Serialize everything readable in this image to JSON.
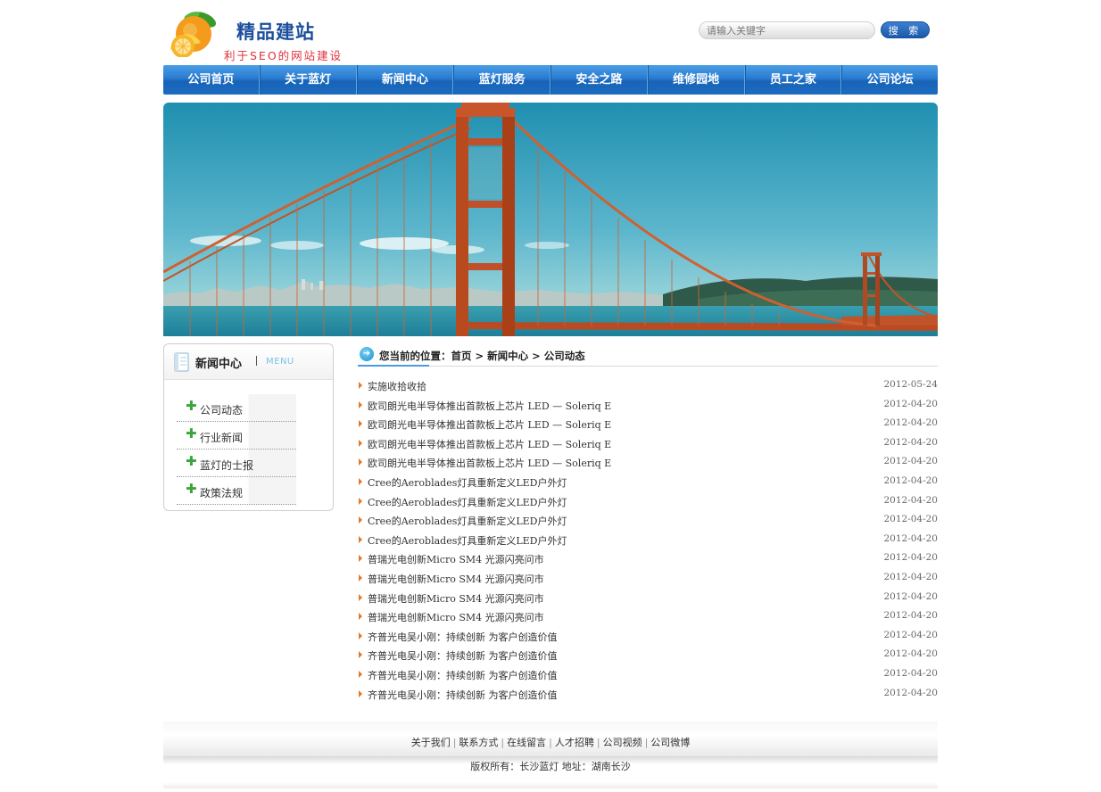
{
  "header": {
    "logo_title": "精品建站",
    "logo_subtitle": "利于SEO的网站建设",
    "search_placeholder": "请输入关键字",
    "search_button": "搜 索"
  },
  "nav": {
    "items": [
      "公司首页",
      "关于蓝灯",
      "新闻中心",
      "蓝灯服务",
      "安全之路",
      "维修园地",
      "员工之家",
      "公司论坛"
    ]
  },
  "sidebar": {
    "title": "新闻中心",
    "menu_label": "MENU",
    "items": [
      "公司动态",
      "行业新闻",
      "蓝灯的士报",
      "政策法规"
    ]
  },
  "breadcrumb": {
    "text": "您当前的位置：首页 > 新闻中心 > 公司动态"
  },
  "news": [
    {
      "title": "实施收拾收拾",
      "date": "2012-05-24"
    },
    {
      "title": "欧司朗光电半导体推出首款板上芯片 LED — Soleriq E",
      "date": "2012-04-20"
    },
    {
      "title": "欧司朗光电半导体推出首款板上芯片 LED — Soleriq E",
      "date": "2012-04-20"
    },
    {
      "title": "欧司朗光电半导体推出首款板上芯片 LED — Soleriq E",
      "date": "2012-04-20"
    },
    {
      "title": "欧司朗光电半导体推出首款板上芯片 LED — Soleriq E",
      "date": "2012-04-20"
    },
    {
      "title": "Cree的Aeroblades灯具重新定义LED户外灯",
      "date": "2012-04-20"
    },
    {
      "title": "Cree的Aeroblades灯具重新定义LED户外灯",
      "date": "2012-04-20"
    },
    {
      "title": "Cree的Aeroblades灯具重新定义LED户外灯",
      "date": "2012-04-20"
    },
    {
      "title": "Cree的Aeroblades灯具重新定义LED户外灯",
      "date": "2012-04-20"
    },
    {
      "title": "普瑞光电创新Micro SM4 光源闪亮问市",
      "date": "2012-04-20"
    },
    {
      "title": "普瑞光电创新Micro SM4 光源闪亮问市",
      "date": "2012-04-20"
    },
    {
      "title": "普瑞光电创新Micro SM4 光源闪亮问市",
      "date": "2012-04-20"
    },
    {
      "title": "普瑞光电创新Micro SM4 光源闪亮问市",
      "date": "2012-04-20"
    },
    {
      "title": "齐普光电吴小刚：持续创新 为客户创造价值",
      "date": "2012-04-20"
    },
    {
      "title": "齐普光电吴小刚：持续创新 为客户创造价值",
      "date": "2012-04-20"
    },
    {
      "title": "齐普光电吴小刚：持续创新 为客户创造价值",
      "date": "2012-04-20"
    },
    {
      "title": "齐普光电吴小刚：持续创新 为客户创造价值",
      "date": "2012-04-20"
    }
  ],
  "footer": {
    "links": [
      "关于我们",
      "联系方式",
      "在线留言",
      "人才招聘",
      "公司视频",
      "公司微博"
    ],
    "copyright": "版权所有：长沙蓝灯 地址：湖南长沙"
  },
  "colors": {
    "nav_blue": "#2a7bd0",
    "logo_blue": "#1c4f9c",
    "logo_red": "#e0303a",
    "arrow_orange": "#e0782b",
    "plus_green": "#3aa53a"
  }
}
